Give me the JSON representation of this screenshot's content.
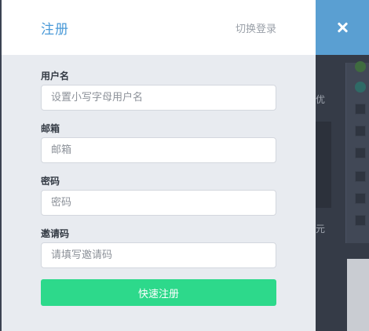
{
  "modal": {
    "title": "注册",
    "switch_link": "切换登录",
    "close_icon": "close-icon",
    "accent_color": "#4a9ad8",
    "submit_color": "#2dd98b"
  },
  "form": {
    "username": {
      "label": "用户名",
      "placeholder": "设置小写字母用户名",
      "value": ""
    },
    "email": {
      "label": "邮箱",
      "placeholder": "邮箱",
      "value": ""
    },
    "password": {
      "label": "密码",
      "placeholder": "密码",
      "value": ""
    },
    "invite": {
      "label": "邀请码",
      "placeholder": "请填写邀请码",
      "value": ""
    },
    "submit_label": "快速注册"
  },
  "background": {
    "glyph_1": "优",
    "glyph_2": "元"
  }
}
